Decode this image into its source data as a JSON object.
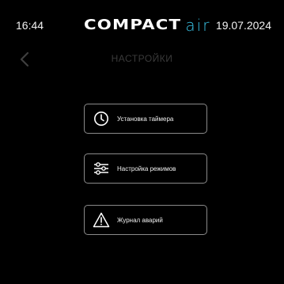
{
  "status_bar": {
    "time": "16:44",
    "date": "19.07.2024",
    "logo": {
      "brand_main": "COMPACT",
      "brand_accent": "air",
      "accent_color": "#39c3e6"
    }
  },
  "header": {
    "title": "НАСТРОЙКИ",
    "back_icon": "chevron-left-icon"
  },
  "menu": {
    "items": [
      {
        "label": "Установка таймера",
        "icon": "clock-icon"
      },
      {
        "label": "Настройка режимов",
        "icon": "sliders-icon"
      },
      {
        "label": "Журнал аварий",
        "icon": "warning-icon"
      }
    ]
  },
  "colors": {
    "background": "#000000",
    "button_border": "#8a8a8a",
    "title_dim": "#3a3a3a",
    "text": "#f0f0f0"
  }
}
